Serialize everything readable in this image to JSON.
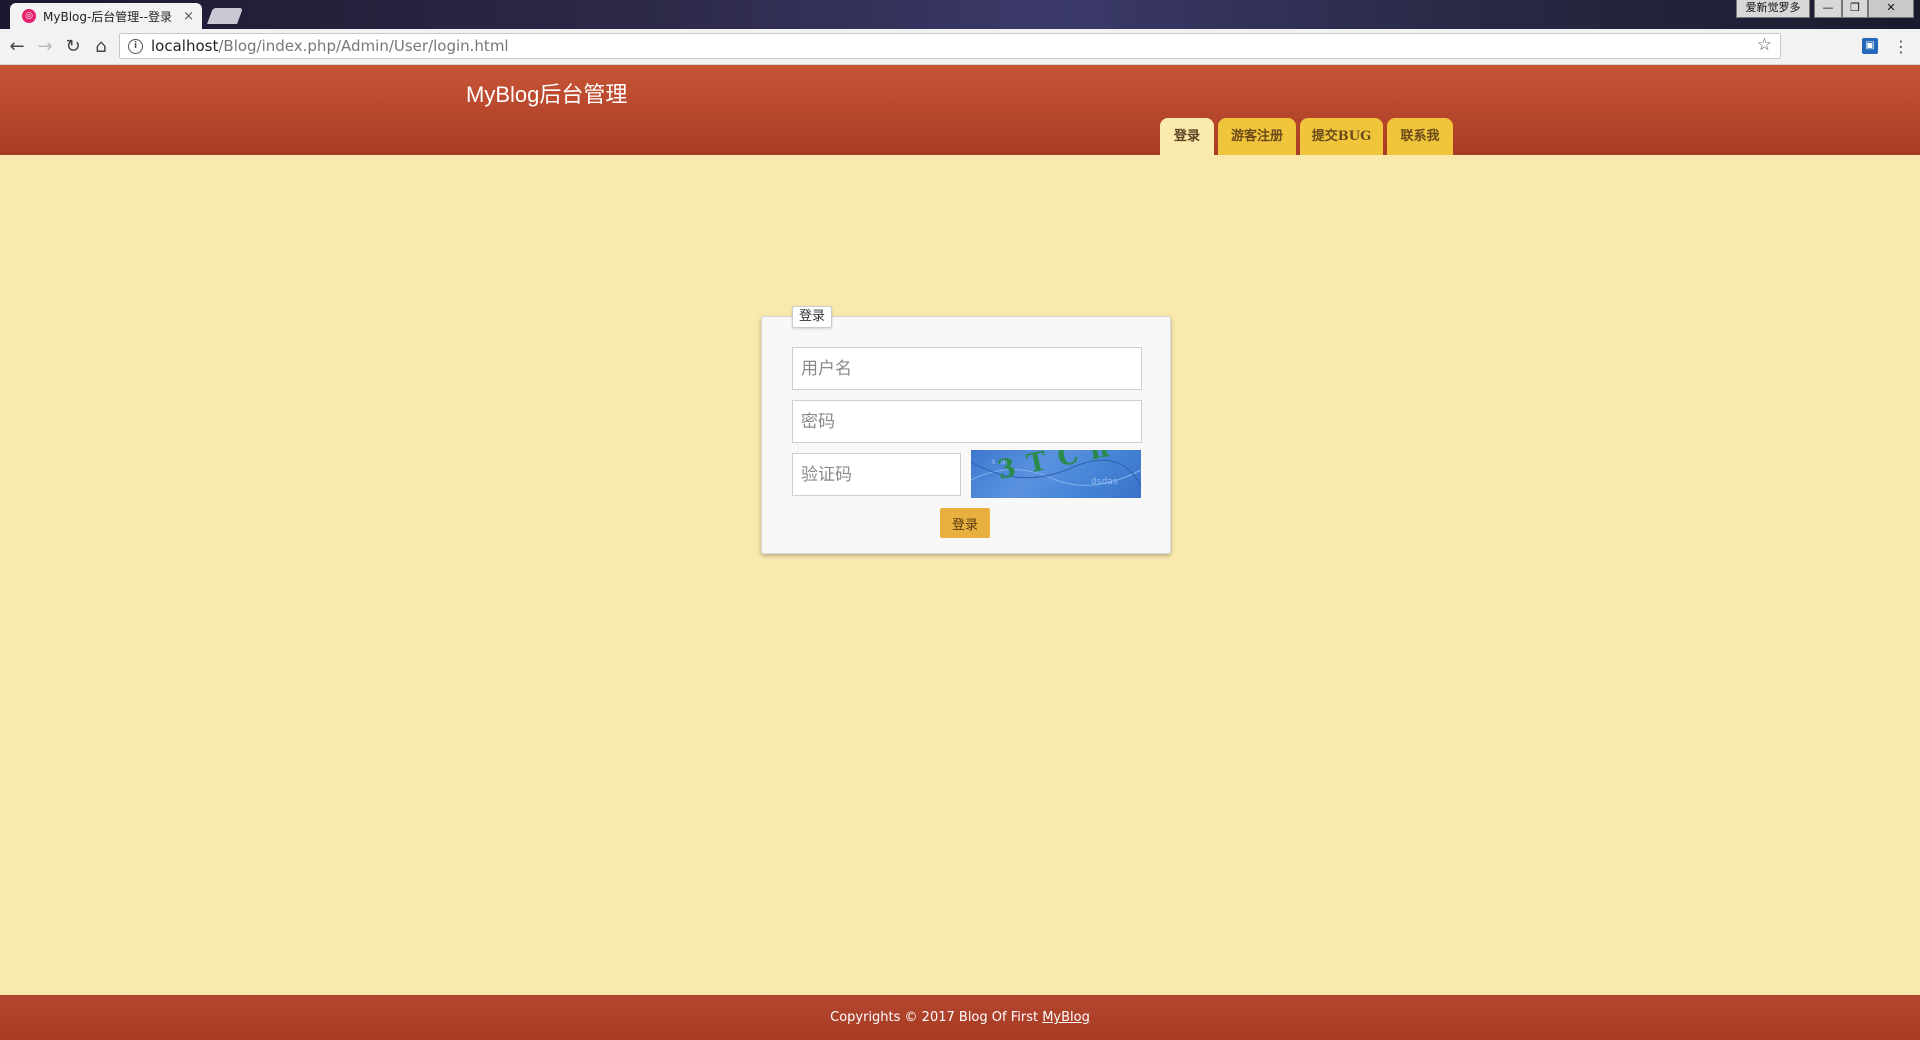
{
  "browser": {
    "tab_title": "MyBlog-后台管理--登录",
    "tab_close": "×",
    "window_extra": "爱新觉罗多",
    "minimize": "—",
    "maximize": "❐",
    "close": "✕",
    "url_host": "localhost",
    "url_path": "/Blog/index.php/Admin/User/login.html"
  },
  "header": {
    "title": "MyBlog后台管理",
    "nav": [
      {
        "label": "登录",
        "active": true
      },
      {
        "label": "游客注册",
        "active": false
      },
      {
        "label": "提交BUG",
        "active": false
      },
      {
        "label": "联系我",
        "active": false
      }
    ]
  },
  "login": {
    "legend": "登录",
    "username_placeholder": "用户名",
    "password_placeholder": "密码",
    "captcha_placeholder": "验证码",
    "captcha_text": "3TCn",
    "submit_label": "登录"
  },
  "footer": {
    "text": "Copyrights © 2017 Blog Of First ",
    "link": "MyBlog"
  }
}
